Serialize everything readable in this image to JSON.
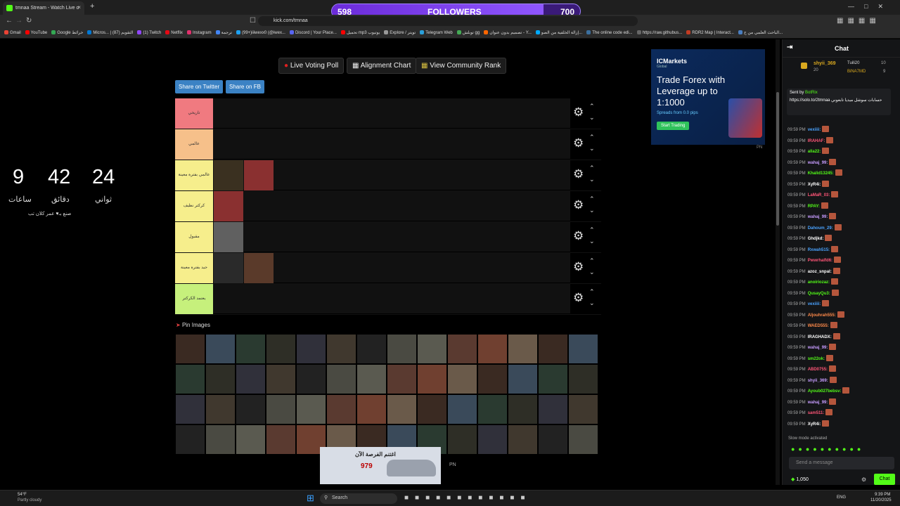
{
  "browser": {
    "tab_title": "tmnaa Stream - Watch Live o",
    "tab_close": "×",
    "new_tab": "+",
    "url": "kick.com/tmnaa",
    "bookmarks": [
      "Gmail",
      "YouTube",
      "Google خرائط",
      "Micros... | التقويم (87)",
      "(1) Twitch",
      "Netflix",
      "Instagram",
      "ترجمة",
      "(99+)iiiwexx0 (@iwex...",
      "Discord | Your Place...",
      "تحميل mp3 يوتيوب",
      "Explore / تويتر",
      "Telegram Web",
      "توبلش gg",
      "تصميم بدون عنوان - Y...",
      "إزالة الخلفية من الصو...",
      "The online code edi...",
      "https://raw.githubus...",
      "RDR2 Map | Interact...",
      "الباحث العلمي من ج..."
    ],
    "window_controls": [
      "—",
      "□",
      "✕"
    ]
  },
  "followers_goal": {
    "current": "598",
    "label": "FOLLOWERS",
    "goal": "700",
    "progress": 0.854
  },
  "toolbar": {
    "live_voting": "Live Voting Poll",
    "alignment_chart": "Alignment Chart",
    "community_rank": "View Community Rank",
    "share_twitter": "Share on Twitter",
    "share_fb": "Share on FB"
  },
  "countdown": {
    "hours": "9",
    "hours_label": "ساعات",
    "minutes": "42",
    "minutes_label": "دقائق",
    "seconds": "24",
    "seconds_label": "ثواني",
    "credit": "صنع بـ♥ عمر كلان تب"
  },
  "tiers": [
    {
      "label": "تاريخي",
      "color": "#f07a80",
      "count": 0
    },
    {
      "label": "عالمي",
      "color": "#f6c08a",
      "count": 0
    },
    {
      "label": "عالمي بفترة معينة",
      "color": "#f6ee8c",
      "count": 2
    },
    {
      "label": "كركتر نظيف",
      "color": "#f6ee8c",
      "count": 1
    },
    {
      "label": "مقبول",
      "color": "#f6ee8c",
      "count": 1
    },
    {
      "label": "جيد بفترة معينة",
      "color": "#f6ee8c",
      "count": 2
    },
    {
      "label": "يعتمد الكركتر",
      "color": "#c6f07c",
      "count": 0
    }
  ],
  "pin_images": {
    "label": "Pin Images"
  },
  "ad1": {
    "brand": "ICMarkets",
    "brand_sub": "Global",
    "headline": "Trade Forex with Leverage up to 1:1000",
    "sub": "Spreads from 0.0 pips",
    "cta": "Start Trading",
    "tag": "PN"
  },
  "ad2": {
    "headline": "اغتنم الفرصة الآن",
    "price": "979",
    "tag": "PN"
  },
  "chat": {
    "title": "Chat",
    "top_user": "shyii_369",
    "top_user_count": "20",
    "top2": "Tuili20",
    "top2_count": "10",
    "top3": "BiNA7MD",
    "top3_count": "9",
    "pinned_by": "Sent by",
    "pinned_bot": "BotRix",
    "pinned_text": "https://solo.to/2tmnaa حسابات سوشل ميديا تابعوني",
    "messages": [
      {
        "time": "09:59 PM",
        "user": "vexiiii:",
        "color": "#4aa3ff"
      },
      {
        "time": "09:59 PM",
        "user": "IRAHAF:",
        "color": "#ff5577"
      },
      {
        "time": "09:59 PM",
        "user": "alla22:",
        "color": "#53fc18"
      },
      {
        "time": "09:59 PM",
        "user": "wahaj_99:",
        "color": "#c79cff"
      },
      {
        "time": "09:59 PM",
        "user": "Khalid13245:",
        "color": "#53fc18"
      },
      {
        "time": "09:59 PM",
        "user": "XyR4i:",
        "color": "#ffffff"
      },
      {
        "time": "09:59 PM",
        "user": "LaMaR_03:",
        "color": "#ff5577"
      },
      {
        "time": "09:59 PM",
        "user": "RPAY:",
        "color": "#53fc18"
      },
      {
        "time": "09:59 PM",
        "user": "wahaj_99:",
        "color": "#c79cff"
      },
      {
        "time": "09:59 PM",
        "user": "Dahoum_29:",
        "color": "#4aa3ff"
      },
      {
        "time": "09:59 PM",
        "user": "Ghdjkd:",
        "color": "#ffffff"
      },
      {
        "time": "09:59 PM",
        "user": "Rxwah515:",
        "color": "#4aa3ff"
      },
      {
        "time": "09:59 PM",
        "user": "Pwwrhalfd6:",
        "color": "#ff5577"
      },
      {
        "time": "09:59 PM",
        "user": "azoz_snpal:",
        "color": "#ffffff"
      },
      {
        "time": "09:59 PM",
        "user": "anoiriozaz:",
        "color": "#53fc18"
      },
      {
        "time": "09:59 PM",
        "user": "QusayQu3:",
        "color": "#53fc18"
      },
      {
        "time": "09:59 PM",
        "user": "vexiiii:",
        "color": "#4aa3ff"
      },
      {
        "time": "09:59 PM",
        "user": "Aljouhrah555:",
        "color": "#ff8a4a"
      },
      {
        "time": "09:59 PM",
        "user": "WAED555:",
        "color": "#ff8a4a"
      },
      {
        "time": "09:59 PM",
        "user": "IRAGHADX:",
        "color": "#ffffff"
      },
      {
        "time": "09:59 PM",
        "user": "wahaj_99:",
        "color": "#c79cff"
      },
      {
        "time": "09:59 PM",
        "user": "sm22ok:",
        "color": "#53fc18"
      },
      {
        "time": "09:59 PM",
        "user": "ABD0755:",
        "color": "#ff5577"
      },
      {
        "time": "09:59 PM",
        "user": "shyii_369:",
        "color": "#c79cff"
      },
      {
        "time": "09:59 PM",
        "user": "Ayoub027bebsv:",
        "color": "#53fc18"
      },
      {
        "time": "09:59 PM",
        "user": "wahaj_99:",
        "color": "#c79cff"
      },
      {
        "time": "09:59 PM",
        "user": "sam511:",
        "color": "#ff5577"
      },
      {
        "time": "09:59 PM",
        "user": "XyR4i:",
        "color": "#ffffff"
      }
    ],
    "slow_mode": "Slow mode activated",
    "input_placeholder": "Send a message",
    "points": "1,050",
    "send": "Chat"
  },
  "taskbar": {
    "weather": "54°F",
    "weather_desc": "Partly cloudy",
    "search": "Search",
    "lang": "ENG",
    "time": "9:39 PM",
    "date": "11/20/2025"
  }
}
